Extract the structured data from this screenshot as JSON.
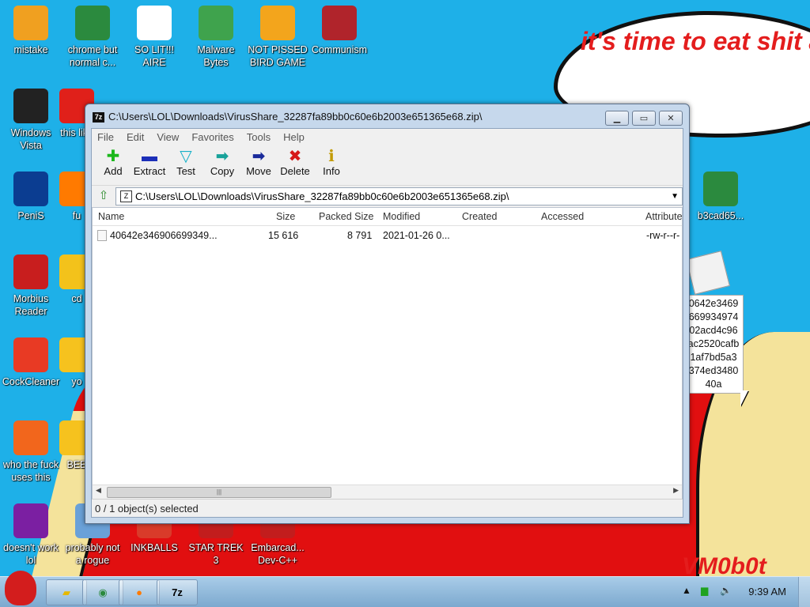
{
  "wallpaper": {
    "bubble_text": "it's time to eat shit and die and chew bubble gum",
    "signature": "VM0b0t"
  },
  "desktop_icons": [
    {
      "label": "mistake",
      "icon": "computer-icon",
      "color": "#f0a020"
    },
    {
      "label": "chrome but normal c...",
      "icon": "chrome-icon",
      "color": "#2b8a3e"
    },
    {
      "label": "SO LIT!!! AIRE",
      "icon": "cards-icon",
      "color": "#ffffff"
    },
    {
      "label": "Malware Bytes",
      "icon": "shield-icon",
      "color": "#3fa34d"
    },
    {
      "label": "NOT PISSED BIRD GAME",
      "icon": "pig-icon",
      "color": "#f3a51c"
    },
    {
      "label": "Communism",
      "icon": "emblem-icon",
      "color": "#b0242b"
    },
    {
      "label": "Windows Vista",
      "icon": "trash-icon",
      "color": "#222222"
    },
    {
      "label": "this like",
      "icon": "opera-icon",
      "color": "#e0201a"
    },
    {
      "label": "PeniS",
      "icon": "photoshop-icon",
      "color": "#0b3d91"
    },
    {
      "label": "fu",
      "icon": "firefox-icon",
      "color": "#ff7a00"
    },
    {
      "label": "Morbius Reader",
      "icon": "pdf-icon",
      "color": "#c81e1e"
    },
    {
      "label": "cd",
      "icon": "disc-icon",
      "color": "#f3c21b"
    },
    {
      "label": "CockCleaner",
      "icon": "ccleaner-icon",
      "color": "#e83a24"
    },
    {
      "label": "yo",
      "icon": "star-icon",
      "color": "#f6c21e"
    },
    {
      "label": "who the fuck uses this",
      "icon": "winamp-icon",
      "color": "#f2661c"
    },
    {
      "label": "BEE",
      "icon": "bee-icon",
      "color": "#f6c21e"
    },
    {
      "label": "doesn't work lol",
      "icon": "yahoo-icon",
      "color": "#7b1fa2"
    },
    {
      "label": "probably not a rogue",
      "icon": "program-icon",
      "color": "#6aa1d8"
    },
    {
      "label": "INKBALLS",
      "icon": "inkball-icon",
      "color": "#d93b2a"
    },
    {
      "label": "STAR TREK 3",
      "icon": "startrek-icon",
      "color": "#c21d1d"
    },
    {
      "label": "Embarcad... Dev-C++",
      "icon": "devcpp-icon",
      "color": "#c21d1d"
    },
    {
      "label": "b3cad65...",
      "icon": "chrome-icon",
      "color": "#2b8a3e"
    }
  ],
  "hash_tooltip": "0642e3469\n669934974\n02acd4c96\nac2520cafb\n1af7bd5a3\n374ed3480\n40a",
  "window": {
    "title": "C:\\Users\\LOL\\Downloads\\VirusShare_32287fa89bb0c60e6b2003e651365e68.zip\\",
    "app_icon": "7z",
    "menu": [
      "File",
      "Edit",
      "View",
      "Favorites",
      "Tools",
      "Help"
    ],
    "toolbar": [
      {
        "label": "Add",
        "glyph": "✚",
        "color": "#1bb81b",
        "icon": "add-icon"
      },
      {
        "label": "Extract",
        "glyph": "▬",
        "color": "#1c2fb8",
        "icon": "extract-icon"
      },
      {
        "label": "Test",
        "glyph": "▽",
        "color": "#16b0c8",
        "icon": "test-icon"
      },
      {
        "label": "Copy",
        "glyph": "➡",
        "color": "#18a29a",
        "icon": "copy-icon"
      },
      {
        "label": "Move",
        "glyph": "➡",
        "color": "#1a2a9a",
        "icon": "move-icon"
      },
      {
        "label": "Delete",
        "glyph": "✖",
        "color": "#d61a1a",
        "icon": "delete-icon"
      },
      {
        "label": "Info",
        "glyph": "ℹ",
        "color": "#c29a00",
        "icon": "info-icon"
      }
    ],
    "address": "C:\\Users\\LOL\\Downloads\\VirusShare_32287fa89bb0c60e6b2003e651365e68.zip\\",
    "columns": [
      "Name",
      "Size",
      "Packed Size",
      "Modified",
      "Created",
      "Accessed",
      "Attribute"
    ],
    "rows": [
      {
        "name": "40642e346906699349...",
        "size": "15 616",
        "packed": "8 791",
        "modified": "2021-01-26 0...",
        "created": "",
        "accessed": "",
        "attributes": "-rw-r--r-"
      }
    ],
    "status": "0 / 1 object(s) selected"
  },
  "taskbar": {
    "clock": "9:39 AM",
    "items": [
      "explorer",
      "chrome",
      "firefox",
      "7z"
    ],
    "active_app_label": "7z"
  }
}
